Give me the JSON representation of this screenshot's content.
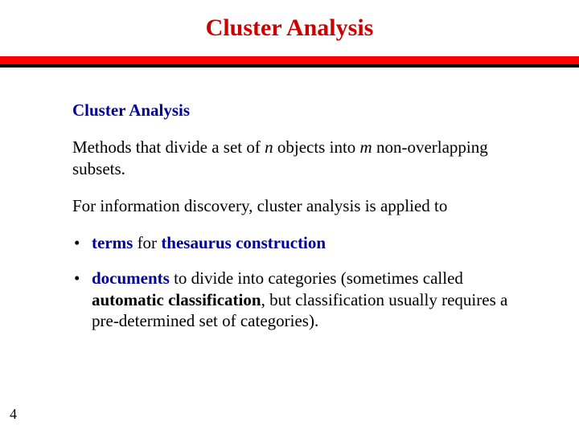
{
  "header": {
    "title": "Cluster Analysis"
  },
  "body": {
    "subtitle": "Cluster Analysis",
    "p1_a": "Methods that divide a set of ",
    "p1_n": "n",
    "p1_b": " objects into ",
    "p1_m": "m",
    "p1_c": " non-overlapping subsets.",
    "p2": "For information discovery, cluster analysis is applied to",
    "b1_kw": "terms",
    "b1_mid": " for ",
    "b1_kw2": "thesaurus construction",
    "b2_kw": "documents",
    "b2_a": " to divide into categories (sometimes called ",
    "b2_bold": "automatic classification",
    "b2_b": ", but classification usually requires a pre-determined set of categories)."
  },
  "page_number": "4"
}
